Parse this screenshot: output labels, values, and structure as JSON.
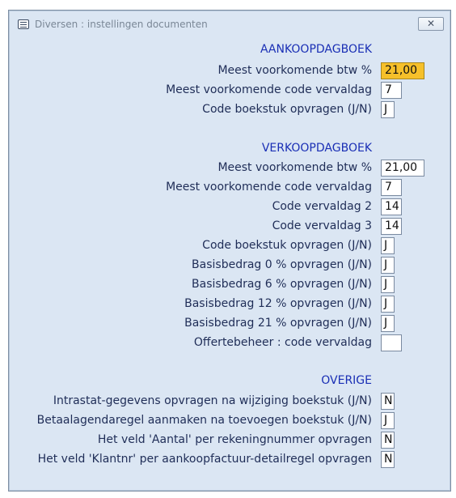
{
  "window": {
    "title": "Diversen : instellingen documenten",
    "close_label": "✕"
  },
  "sections": {
    "aankoop": {
      "header": "AANKOOPDAGBOEK",
      "rows": [
        {
          "label": "Meest voorkomende btw %",
          "value": "21,00"
        },
        {
          "label": "Meest voorkomende code vervaldag",
          "value": "7"
        },
        {
          "label": "Code boekstuk opvragen (J/N)",
          "value": "J"
        }
      ]
    },
    "verkoop": {
      "header": "VERKOOPDAGBOEK",
      "rows": [
        {
          "label": "Meest voorkomende btw %",
          "value": "21,00"
        },
        {
          "label": "Meest voorkomende code vervaldag",
          "value": "7"
        },
        {
          "label": "Code vervaldag 2",
          "value": "14"
        },
        {
          "label": "Code vervaldag 3",
          "value": "14"
        },
        {
          "label": "Code boekstuk opvragen (J/N)",
          "value": "J"
        },
        {
          "label": "Basisbedrag 0 % opvragen (J/N)",
          "value": "J"
        },
        {
          "label": "Basisbedrag 6 % opvragen (J/N)",
          "value": "J"
        },
        {
          "label": "Basisbedrag 12 % opvragen (J/N)",
          "value": "J"
        },
        {
          "label": "Basisbedrag 21 % opvragen (J/N)",
          "value": "J"
        },
        {
          "label": "Offertebeheer : code vervaldag",
          "value": ""
        }
      ]
    },
    "overige": {
      "header": "OVERIGE",
      "rows": [
        {
          "label": "Intrastat-gegevens opvragen na wijziging boekstuk (J/N)",
          "value": "N"
        },
        {
          "label": "Betaalagendaregel aanmaken na toevoegen boekstuk (J/N)",
          "value": "J"
        },
        {
          "label": "Het veld 'Aantal' per rekeningnummer opvragen",
          "value": "N"
        },
        {
          "label": "Het veld 'Klantnr' per aankoopfactuur-detailregel opvragen",
          "value": "N"
        }
      ]
    }
  },
  "colors": {
    "highlight": "#f6c02a",
    "section_header": "#1a2fb5",
    "window_bg": "#dbe6f3"
  },
  "icons": {
    "title": "window-menu-icon",
    "close": "close-icon"
  }
}
